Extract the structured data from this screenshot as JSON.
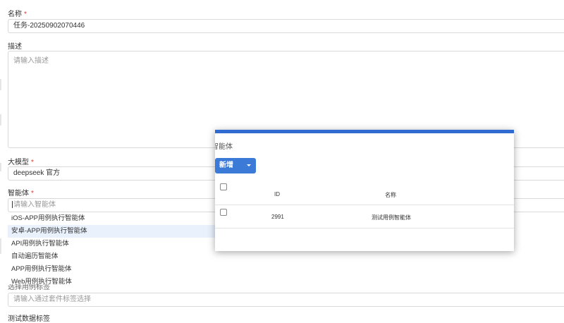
{
  "form": {
    "name_label": "名称",
    "name_value": "任务-20250902070446",
    "required_mark": "*",
    "desc_label": "描述",
    "desc_placeholder": "请输入描述",
    "model_label": "大模型",
    "model_value": "deepseek 官方",
    "agent_label": "智能体",
    "agent_placeholder": "请输入智能体",
    "case_label_partial": "选择用例标签",
    "case_placeholder": "请输入通过套件标签选择",
    "testdata_label": "测试数据标签"
  },
  "agent_dropdown": {
    "options": [
      "iOS-APP用例执行智能体",
      "安卓-APP用例执行智能体",
      "API用例执行智能体",
      "自动遍历智能体",
      "APP用例执行智能体",
      "Web用例执行智能体"
    ],
    "highlighted": "安卓-APP用例执行智能体"
  },
  "modal": {
    "title": "智能体",
    "add_button": "新增",
    "columns": [
      "ID",
      "名称"
    ],
    "rows": [
      {
        "id": "2991",
        "name": "测试用例智能体"
      }
    ]
  },
  "colors": {
    "accent": "#2f6bd1",
    "button": "#3b7ad6",
    "required": "#e53935",
    "highlight_row": "#e8f1fc"
  }
}
